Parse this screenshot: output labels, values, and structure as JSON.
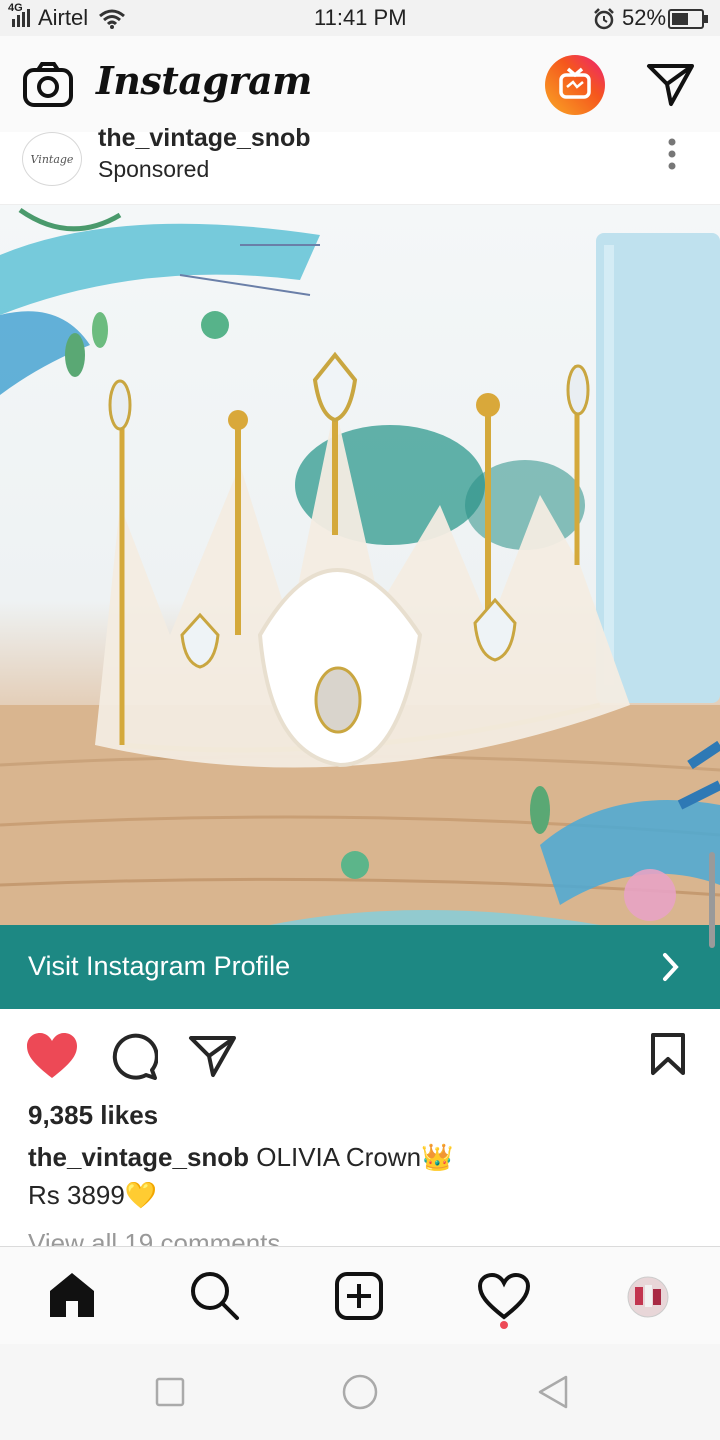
{
  "status_bar": {
    "network": "4G",
    "carrier": "Airtel",
    "time": "11:41 PM",
    "battery": "52%"
  },
  "header": {
    "app_name": "Instagram",
    "icons": [
      "camera-icon",
      "igtv-icon",
      "direct-message-icon"
    ]
  },
  "post": {
    "username": "the_vintage_snob",
    "avatar_text": "Vintage",
    "label": "Sponsored",
    "cta_label": "Visit Instagram Profile",
    "likes": "9,385 likes",
    "caption_user": "the_vintage_snob",
    "caption_text": "OLIVIA Crown👑",
    "price_line": "Rs 3899💛",
    "comments_link": "View all 19 comments",
    "liked": true,
    "colors": {
      "cta_background": "#1d8883",
      "like_red": "#ed4956"
    }
  },
  "bottom_nav": {
    "items": [
      "home-icon",
      "search-icon",
      "new-post-icon",
      "activity-icon",
      "profile-avatar"
    ],
    "active": "home-icon"
  },
  "system_nav": [
    "recent-apps-icon",
    "home-circle-icon",
    "back-icon"
  ]
}
